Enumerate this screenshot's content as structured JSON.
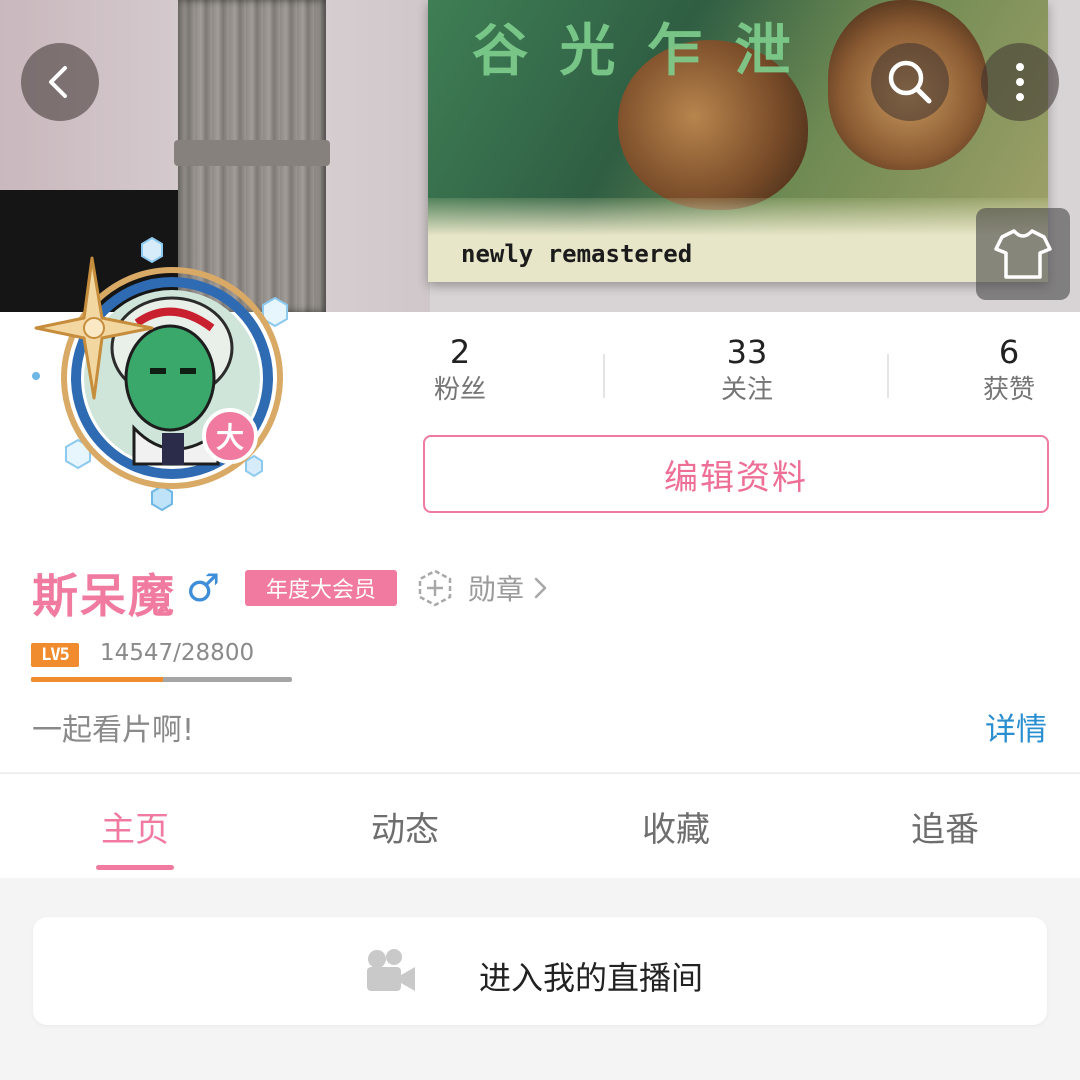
{
  "header": {
    "back_icon": "chevron-left-icon",
    "search_icon": "search-icon",
    "more_icon": "more-vertical-icon",
    "skin_icon": "tshirt-icon",
    "banner_poster_text": "newly remastered"
  },
  "stats": [
    {
      "value": "2",
      "label": "粉丝"
    },
    {
      "value": "33",
      "label": "关注"
    },
    {
      "value": "6",
      "label": "获赞"
    }
  ],
  "edit_profile_label": "编辑资料",
  "user": {
    "name": "斯呆魔",
    "gender_symbol": "♂",
    "vip_label": "年度大会员",
    "avatar_badge": "大",
    "medal_label": "勋章",
    "level_label": "LV5",
    "exp_text": "14547/28800",
    "exp_progress": 0.505,
    "signature": "一起看片啊!",
    "detail_link": "详情"
  },
  "tabs": [
    {
      "label": "主页",
      "active": true
    },
    {
      "label": "动态",
      "active": false
    },
    {
      "label": "收藏",
      "active": false
    },
    {
      "label": "追番",
      "active": false
    }
  ],
  "live_room": {
    "label": "进入我的直播间",
    "icon": "video-camera-icon"
  },
  "colors": {
    "accent_pink": "#f07aa0",
    "link_blue": "#2a8fd0",
    "level_orange": "#f08c2e",
    "gender_blue": "#3f8ed8"
  }
}
